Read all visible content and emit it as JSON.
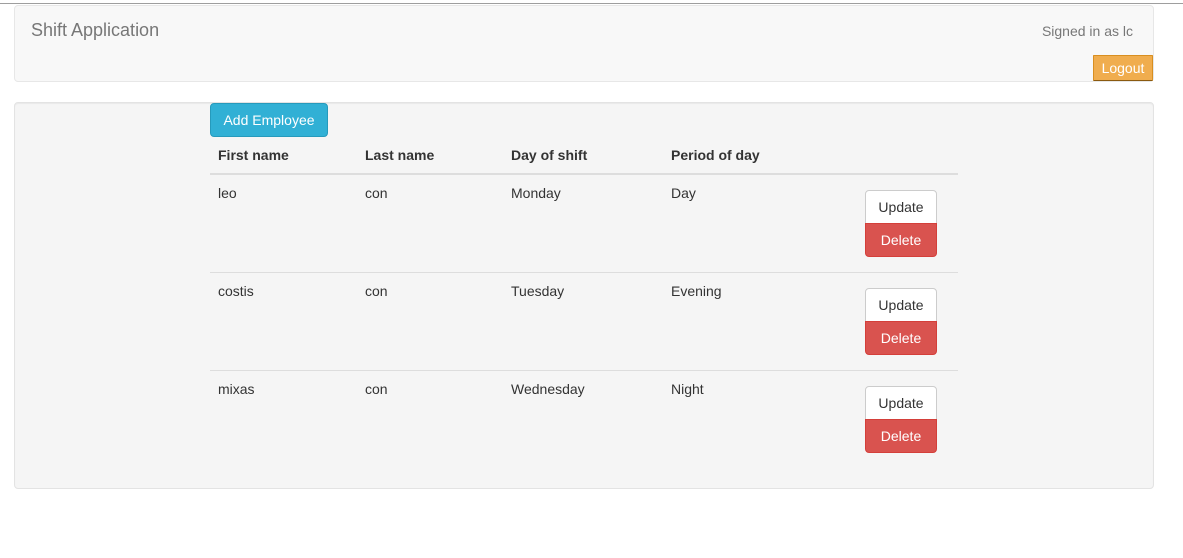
{
  "navbar": {
    "brand": "Shift Application",
    "signed_in_text": "Signed in as lc",
    "logout_label": "Logout"
  },
  "toolbar": {
    "add_employee_label": "Add Employee"
  },
  "table": {
    "headers": [
      "First name",
      "Last name",
      "Day of shift",
      "Period of day"
    ],
    "rows": [
      {
        "first_name": "leo",
        "last_name": "con",
        "day": "Monday",
        "period": "Day",
        "update_label": "Update",
        "delete_label": "Delete"
      },
      {
        "first_name": "costis",
        "last_name": "con",
        "day": "Tuesday",
        "period": "Evening",
        "update_label": "Update",
        "delete_label": "Delete"
      },
      {
        "first_name": "mixas",
        "last_name": "con",
        "day": "Wednesday",
        "period": "Night",
        "update_label": "Update",
        "delete_label": "Delete"
      }
    ]
  },
  "colors": {
    "logout": "#f0ad4e",
    "add_employee": "#31b0d5",
    "delete": "#d9534f"
  }
}
